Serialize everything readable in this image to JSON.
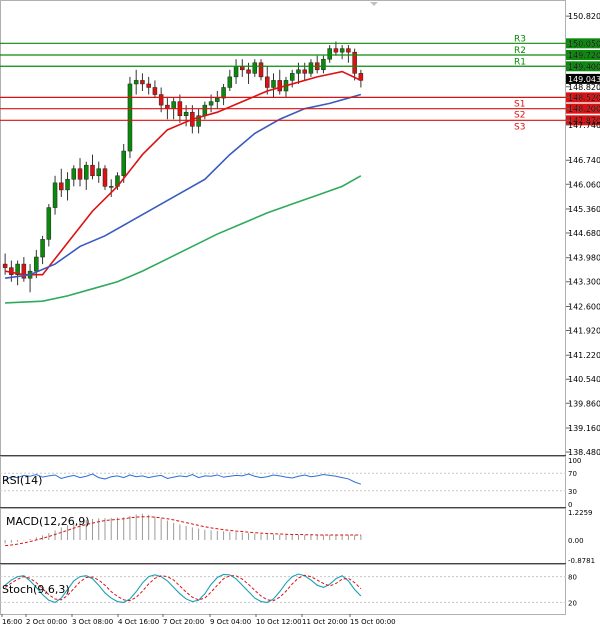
{
  "chart_data": [
    {
      "type": "candlestick",
      "panel": "main",
      "y_axis_ticks": [
        "150.820",
        "150.050",
        "149.720",
        "149.400",
        "149.043",
        "148.820",
        "148.520",
        "148.200",
        "147.870",
        "147.740",
        "146.740",
        "146.060",
        "145.360",
        "144.680",
        "143.980",
        "143.300",
        "142.600",
        "141.920",
        "141.220",
        "140.540",
        "139.860",
        "139.160",
        "138.480"
      ],
      "ylim": [
        138.48,
        151.05
      ],
      "x_axis_ticks": [
        "16:00",
        "2 Oct 00:00",
        "3 Oct 08:00",
        "4 Oct 16:00",
        "7 Oct 20:00",
        "9 Oct 04:00",
        "10 Oct 12:00",
        "11 Oct 20:00",
        "15 Oct 00:00"
      ],
      "current_price": "149.043",
      "levels": [
        {
          "name": "R3",
          "value": 150.05,
          "label": "150.050",
          "color": "#0a8a0a"
        },
        {
          "name": "R2",
          "value": 149.72,
          "label": "149.720",
          "color": "#0a8a0a"
        },
        {
          "name": "R1",
          "value": 149.4,
          "label": "149.400",
          "color": "#0a8a0a"
        },
        {
          "name": "S1",
          "value": 148.52,
          "label": "148.520",
          "color": "#dd1111"
        },
        {
          "name": "S2",
          "value": 148.2,
          "label": "148.200",
          "color": "#dd1111"
        },
        {
          "name": "S3",
          "value": 147.87,
          "label": "147.870",
          "color": "#dd1111"
        }
      ],
      "candles": [
        [
          143.8,
          144.1,
          143.5,
          143.7
        ],
        [
          143.7,
          143.9,
          143.3,
          143.5
        ],
        [
          143.5,
          143.9,
          143.2,
          143.8
        ],
        [
          143.8,
          144.0,
          143.3,
          143.4
        ],
        [
          143.4,
          143.8,
          143.0,
          143.6
        ],
        [
          143.6,
          144.2,
          143.4,
          144.0
        ],
        [
          144.0,
          144.6,
          143.8,
          144.5
        ],
        [
          144.5,
          145.5,
          144.3,
          145.4
        ],
        [
          145.4,
          146.3,
          145.2,
          146.1
        ],
        [
          146.1,
          146.5,
          145.7,
          145.9
        ],
        [
          145.9,
          146.4,
          145.6,
          146.2
        ],
        [
          146.2,
          146.6,
          146.0,
          146.5
        ],
        [
          146.5,
          146.8,
          146.0,
          146.2
        ],
        [
          146.2,
          146.7,
          145.9,
          146.6
        ],
        [
          146.6,
          146.9,
          146.2,
          146.3
        ],
        [
          146.3,
          146.7,
          146.1,
          146.5
        ],
        [
          146.5,
          146.6,
          145.9,
          146.0
        ],
        [
          146.0,
          146.2,
          145.7,
          146.0
        ],
        [
          146.0,
          146.4,
          145.9,
          146.3
        ],
        [
          146.3,
          147.2,
          146.1,
          147.0
        ],
        [
          147.0,
          149.1,
          146.8,
          148.9
        ],
        [
          148.9,
          149.3,
          148.6,
          149.0
        ],
        [
          149.0,
          149.2,
          148.7,
          148.9
        ],
        [
          148.9,
          149.1,
          148.6,
          148.8
        ],
        [
          148.8,
          149.0,
          148.5,
          148.6
        ],
        [
          148.6,
          148.8,
          148.1,
          148.3
        ],
        [
          148.3,
          148.5,
          147.9,
          148.2
        ],
        [
          148.2,
          148.5,
          147.9,
          148.4
        ],
        [
          148.4,
          148.6,
          147.8,
          148.0
        ],
        [
          148.0,
          148.3,
          147.7,
          148.1
        ],
        [
          148.1,
          148.3,
          147.5,
          147.7
        ],
        [
          147.7,
          148.2,
          147.5,
          148.0
        ],
        [
          148.0,
          148.4,
          147.9,
          148.3
        ],
        [
          148.3,
          148.6,
          148.1,
          148.4
        ],
        [
          148.4,
          148.7,
          148.2,
          148.5
        ],
        [
          148.5,
          148.9,
          148.3,
          148.8
        ],
        [
          148.8,
          149.3,
          148.7,
          149.1
        ],
        [
          149.1,
          149.6,
          148.9,
          149.4
        ],
        [
          149.4,
          149.6,
          149.1,
          149.3
        ],
        [
          149.3,
          149.5,
          148.9,
          149.2
        ],
        [
          149.2,
          149.6,
          149.1,
          149.5
        ],
        [
          149.5,
          149.6,
          149.0,
          149.1
        ],
        [
          149.1,
          149.4,
          148.6,
          148.8
        ],
        [
          148.8,
          149.2,
          148.5,
          149.0
        ],
        [
          149.0,
          149.3,
          148.6,
          148.7
        ],
        [
          148.7,
          149.1,
          148.5,
          149.0
        ],
        [
          149.0,
          149.3,
          148.8,
          149.2
        ],
        [
          149.2,
          149.5,
          148.9,
          149.3
        ],
        [
          149.3,
          149.5,
          149.0,
          149.2
        ],
        [
          149.2,
          149.6,
          149.1,
          149.5
        ],
        [
          149.5,
          149.7,
          149.2,
          149.3
        ],
        [
          149.3,
          149.7,
          149.2,
          149.6
        ],
        [
          149.6,
          150.0,
          149.5,
          149.9
        ],
        [
          149.9,
          150.1,
          149.7,
          149.8
        ],
        [
          149.8,
          150.0,
          149.6,
          149.9
        ],
        [
          149.9,
          150.0,
          149.5,
          149.8
        ],
        [
          149.8,
          149.9,
          149.0,
          149.2
        ],
        [
          149.2,
          149.3,
          148.8,
          149.0
        ]
      ],
      "ma_series": [
        {
          "color": "#dd1111",
          "values": [
            [
              0,
              143.6
            ],
            [
              3,
              143.5
            ],
            [
              6,
              143.5
            ],
            [
              10,
              144.4
            ],
            [
              14,
              145.3
            ],
            [
              18,
              146.0
            ],
            [
              22,
              146.9
            ],
            [
              26,
              147.6
            ],
            [
              30,
              147.9
            ],
            [
              34,
              148.1
            ],
            [
              38,
              148.4
            ],
            [
              42,
              148.7
            ],
            [
              46,
              148.9
            ],
            [
              50,
              149.1
            ],
            [
              54,
              149.25
            ],
            [
              57,
              149.0
            ]
          ]
        },
        {
          "color": "#3a5bbf",
          "values": [
            [
              0,
              143.4
            ],
            [
              4,
              143.5
            ],
            [
              8,
              143.8
            ],
            [
              12,
              144.3
            ],
            [
              16,
              144.6
            ],
            [
              20,
              145.0
            ],
            [
              24,
              145.4
            ],
            [
              28,
              145.8
            ],
            [
              32,
              146.2
            ],
            [
              36,
              146.9
            ],
            [
              40,
              147.5
            ],
            [
              44,
              147.9
            ],
            [
              48,
              148.2
            ],
            [
              52,
              148.35
            ],
            [
              55,
              148.5
            ],
            [
              57,
              148.6
            ]
          ]
        },
        {
          "color": "#2eaa5c",
          "values": [
            [
              0,
              142.7
            ],
            [
              6,
              142.75
            ],
            [
              10,
              142.9
            ],
            [
              14,
              143.1
            ],
            [
              18,
              143.3
            ],
            [
              22,
              143.6
            ],
            [
              26,
              143.95
            ],
            [
              30,
              144.3
            ],
            [
              34,
              144.65
            ],
            [
              38,
              144.95
            ],
            [
              42,
              145.25
            ],
            [
              46,
              145.5
            ],
            [
              50,
              145.75
            ],
            [
              54,
              146.0
            ],
            [
              57,
              146.3
            ]
          ]
        }
      ]
    },
    {
      "type": "line",
      "panel": "rsi",
      "title": "RSI(14)",
      "y_axis_ticks": [
        "100",
        "70",
        "30",
        "0"
      ],
      "ylim": [
        0,
        100
      ],
      "values": [
        55,
        62,
        60,
        65,
        63,
        67,
        61,
        64,
        66,
        58,
        62,
        65,
        60,
        63,
        68,
        60,
        57,
        62,
        64,
        60,
        66,
        62,
        64,
        60,
        63,
        65,
        58,
        61,
        64,
        62,
        67,
        60,
        64,
        63,
        66,
        61,
        63,
        65,
        64,
        68,
        63,
        60,
        62,
        66,
        64,
        61,
        59,
        63,
        66,
        62,
        64,
        67,
        65,
        63,
        60,
        57,
        50,
        45
      ]
    },
    {
      "type": "bar",
      "panel": "macd",
      "title": "MACD(12,26,9)",
      "y_axis_ticks": [
        "1.2259",
        "0.00",
        "-0.8781"
      ],
      "ylim": [
        -0.8781,
        1.2259
      ],
      "values": [
        -0.15,
        -0.12,
        -0.08,
        -0.02,
        0.05,
        0.12,
        0.2,
        0.3,
        0.42,
        0.55,
        0.65,
        0.75,
        0.82,
        0.88,
        0.92,
        0.95,
        0.96,
        0.97,
        0.98,
        0.99,
        1.05,
        1.12,
        1.15,
        1.1,
        1.02,
        0.95,
        0.85,
        0.75,
        0.68,
        0.62,
        0.55,
        0.5,
        0.45,
        0.42,
        0.4,
        0.38,
        0.36,
        0.34,
        0.32,
        0.3,
        0.28,
        0.26,
        0.25,
        0.24,
        0.23,
        0.22,
        0.22,
        0.22,
        0.22,
        0.23,
        0.22,
        0.22,
        0.22,
        0.22,
        0.22,
        0.22,
        0.22,
        0.22
      ],
      "signal": [
        -0.25,
        -0.22,
        -0.18,
        -0.13,
        -0.07,
        0.0,
        0.07,
        0.15,
        0.24,
        0.33,
        0.42,
        0.52,
        0.6,
        0.68,
        0.74,
        0.8,
        0.85,
        0.88,
        0.9,
        0.93,
        0.97,
        1.0,
        1.02,
        1.02,
        1.0,
        0.97,
        0.93,
        0.88,
        0.82,
        0.76,
        0.7,
        0.64,
        0.58,
        0.53,
        0.49,
        0.45,
        0.42,
        0.39,
        0.37,
        0.34,
        0.32,
        0.3,
        0.28,
        0.27,
        0.26,
        0.25,
        0.24,
        0.24,
        0.23,
        0.23,
        0.22,
        0.22,
        0.22,
        0.22,
        0.22,
        0.22,
        0.22,
        0.22
      ]
    },
    {
      "type": "line",
      "panel": "stochastic",
      "title": "Stoch(9,6,3)",
      "y_axis_ticks": [
        "80",
        "20"
      ],
      "ylim": [
        0,
        100
      ],
      "k": [
        60,
        72,
        80,
        82,
        70,
        55,
        38,
        25,
        20,
        30,
        50,
        70,
        80,
        82,
        75,
        60,
        42,
        30,
        22,
        20,
        28,
        45,
        65,
        80,
        84,
        80,
        70,
        55,
        40,
        28,
        22,
        25,
        40,
        62,
        78,
        85,
        84,
        75,
        60,
        45,
        30,
        22,
        20,
        28,
        45,
        65,
        80,
        86,
        82,
        72,
        60,
        55,
        62,
        75,
        82,
        70,
        50,
        35
      ],
      "d": [
        55,
        65,
        74,
        80,
        76,
        66,
        52,
        38,
        28,
        26,
        36,
        52,
        68,
        78,
        79,
        72,
        60,
        45,
        34,
        26,
        24,
        32,
        46,
        63,
        76,
        82,
        80,
        72,
        58,
        44,
        32,
        26,
        30,
        44,
        60,
        75,
        82,
        82,
        74,
        62,
        48,
        35,
        26,
        24,
        32,
        46,
        63,
        77,
        83,
        80,
        72,
        64,
        58,
        64,
        74,
        76,
        66,
        52
      ]
    }
  ]
}
